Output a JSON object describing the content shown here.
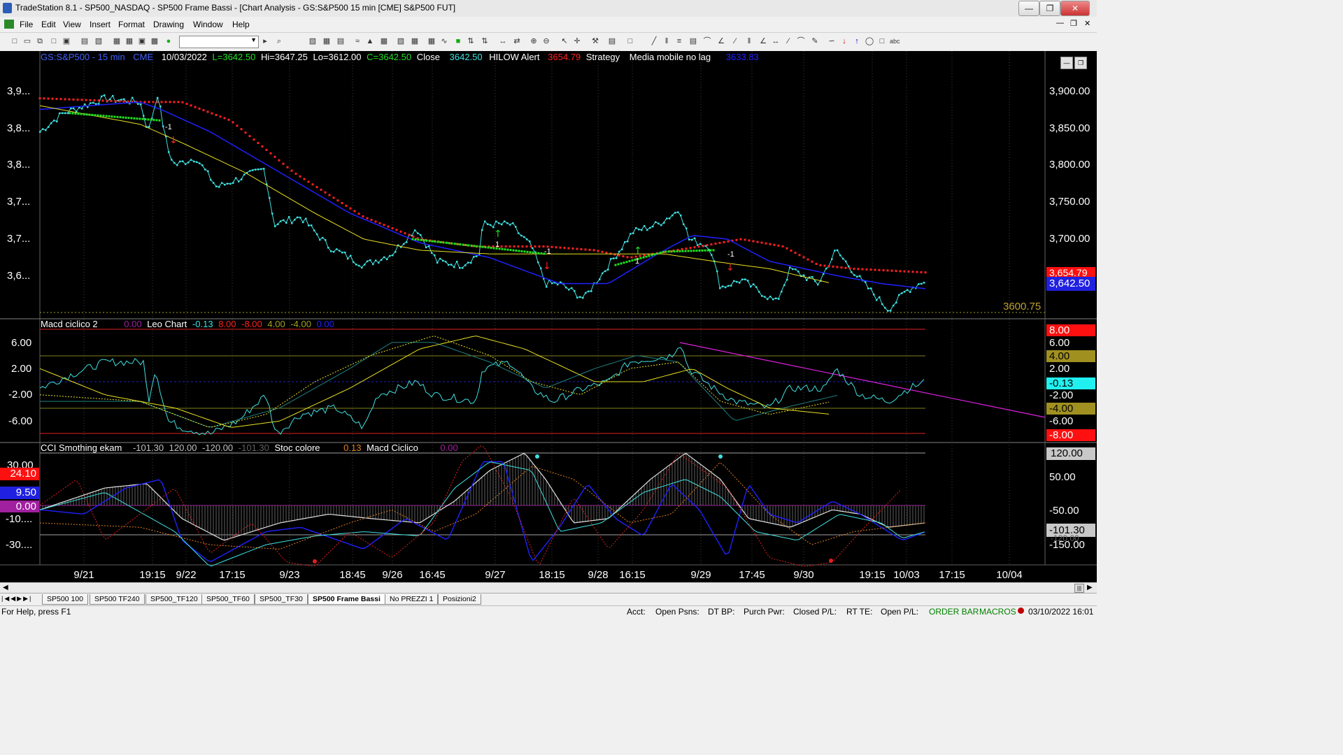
{
  "window": {
    "title": "TradeStation 8.1 - SP500_NASDAQ - SP500 Frame Bassi - [Chart Analysis - GS:S&P500  15 min  [CME] S&P500 FUT]"
  },
  "menu": [
    "File",
    "Edit",
    "View",
    "Insert",
    "Format",
    "Drawing",
    "Window",
    "Help"
  ],
  "chart_header": {
    "symbol": "GS:S&P500 - 15 min",
    "exchange": "CME",
    "date": "10/03/2022",
    "last": "L=3642.50",
    "high": "Hi=3647.25",
    "low": "Lo=3612.00",
    "close_c": "C=3642.50",
    "close_label": "Close",
    "close_value": "3642.50",
    "hilow_label": "HILOW Alert",
    "hilow_value": "3654.79",
    "strategy": "Strategy",
    "mm_label": "Media mobile no lag",
    "mm_value": "3633.83"
  },
  "price_axis": {
    "left_ticks": [
      "3,9...",
      "3,8...",
      "3,8...",
      "3,7...",
      "3,7...",
      "3,6..."
    ],
    "right_ticks": [
      "3,900.00",
      "3,850.00",
      "3,800.00",
      "3,750.00",
      "3,700.00"
    ],
    "badge_hilow": "3,654.79",
    "badge_close": "3,642.50",
    "low_line_label": "3600.75"
  },
  "markers": {
    "minus_one": "-1",
    "plus_one": "1"
  },
  "macd_panel": {
    "title": "Macd ciclico 2",
    "v1": "0.00",
    "leo": "Leo Chart",
    "v2": "-0.13",
    "v3": "8.00",
    "v4": "-8.00",
    "v5": "4.00",
    "v6": "-4.00",
    "v7": "0.00",
    "left_ticks": [
      "6.00",
      "2.00",
      "-2.00",
      "-6.00"
    ],
    "right_ticks": [
      "8.00",
      "6.00",
      "4.00",
      "2.00",
      "-0.13",
      "-2.00",
      "-4.00",
      "-6.00",
      "-8.00"
    ]
  },
  "cci_panel": {
    "title": "CCI Smothing ekam",
    "v1": "-101.30",
    "v2": "120.00",
    "v3": "-120.00",
    "v4": "-101.30",
    "stoc": "Stoc colore",
    "stoc_value": "0.13",
    "macd_label": "Macd Ciclico",
    "macd_value": "0.00",
    "left_ticks": [
      "30.00",
      "24.10",
      "9.50",
      "0.00",
      "-10....",
      "-30...."
    ],
    "right_ticks": [
      "120.00",
      "50.00",
      "-50.00",
      "-101.30",
      "-120.00",
      "-150.00"
    ]
  },
  "time_axis": [
    "9/21",
    "19:15",
    "9/22",
    "17:15",
    "9/23",
    "18:45",
    "9/26",
    "16:45",
    "9/27",
    "18:15",
    "9/28",
    "16:15",
    "9/29",
    "17:45",
    "9/30",
    "19:15",
    "10/03",
    "17:15",
    "10/04"
  ],
  "tabs": [
    "SP500 100",
    "SP500 TF240",
    "SP500_TF120",
    "SP500_TF60",
    "SP500_TF30",
    "SP500 Frame Bassi",
    "No PREZZI 1",
    "Posizioni2"
  ],
  "active_tab": "SP500 Frame Bassi",
  "status": {
    "help": "For Help, press F1",
    "acct": "Acct:",
    "open_psns": "Open Psns:",
    "dt_bp": "DT BP:",
    "purch_pwr": "Purch Pwr:",
    "closed_pl": "Closed P/L:",
    "rt_te": "RT TE:",
    "open_pl": "Open P/L:",
    "order_bar": "ORDER BAR",
    "macros": "MACROS",
    "datetime": "03/10/2022 16:01"
  },
  "colors": {
    "price": "#40e0e0",
    "hilow": "#ff2020",
    "mm": "#2020ff",
    "yellow": "#e8e020",
    "green": "#20e020",
    "magenta": "#e020e0"
  },
  "chart_data": {
    "type": "line",
    "x": [
      "9/21",
      "9/22",
      "9/23",
      "9/26",
      "9/27",
      "9/28",
      "9/29",
      "9/30",
      "10/03"
    ],
    "series": [
      {
        "name": "Close",
        "values": [
          3865,
          3790,
          3720,
          3665,
          3720,
          3620,
          3700,
          3640,
          3642.5
        ]
      },
      {
        "name": "HILOW Alert",
        "values": [
          3890,
          3880,
          3780,
          3690,
          3680,
          3680,
          3690,
          3670,
          3654.79
        ]
      },
      {
        "name": "Media mobile no lag",
        "values": [
          3880,
          3840,
          3760,
          3680,
          3670,
          3650,
          3690,
          3650,
          3633.83
        ]
      }
    ],
    "ylim": [
      3600,
      3910
    ]
  }
}
